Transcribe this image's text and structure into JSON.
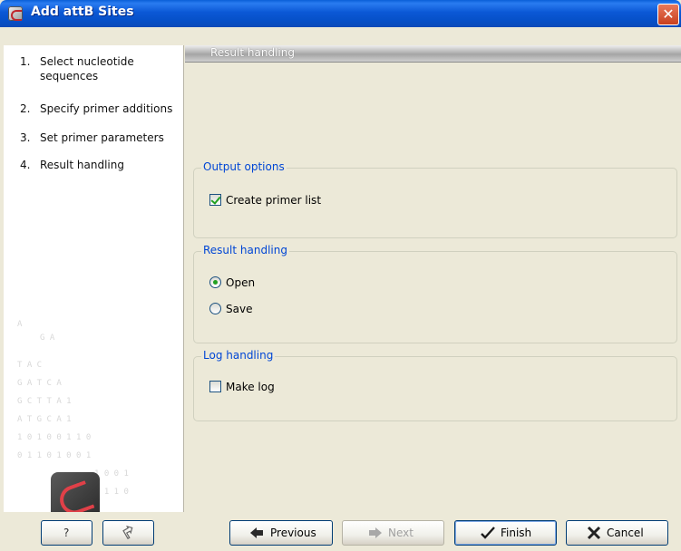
{
  "window": {
    "title": "Add attB Sites"
  },
  "sidebar": {
    "steps": [
      {
        "num": "1.",
        "label": "Select nucleotide sequences"
      },
      {
        "num": "2.",
        "label": "Specify primer additions"
      },
      {
        "num": "3.",
        "label": "Set primer parameters"
      },
      {
        "num": "4.",
        "label": "Result handling"
      }
    ]
  },
  "main": {
    "header": "Result handling",
    "output_options": {
      "title": "Output options",
      "create_primer_list": {
        "label": "Create primer list",
        "checked": true
      }
    },
    "result_handling": {
      "title": "Result handling",
      "open": {
        "label": "Open",
        "selected": true
      },
      "save": {
        "label": "Save",
        "selected": false
      }
    },
    "log_handling": {
      "title": "Log handling",
      "make_log": {
        "label": "Make log",
        "checked": false
      }
    }
  },
  "buttons": {
    "help": "?",
    "previous": "Previous",
    "next": "Next",
    "finish": "Finish",
    "cancel": "Cancel"
  }
}
